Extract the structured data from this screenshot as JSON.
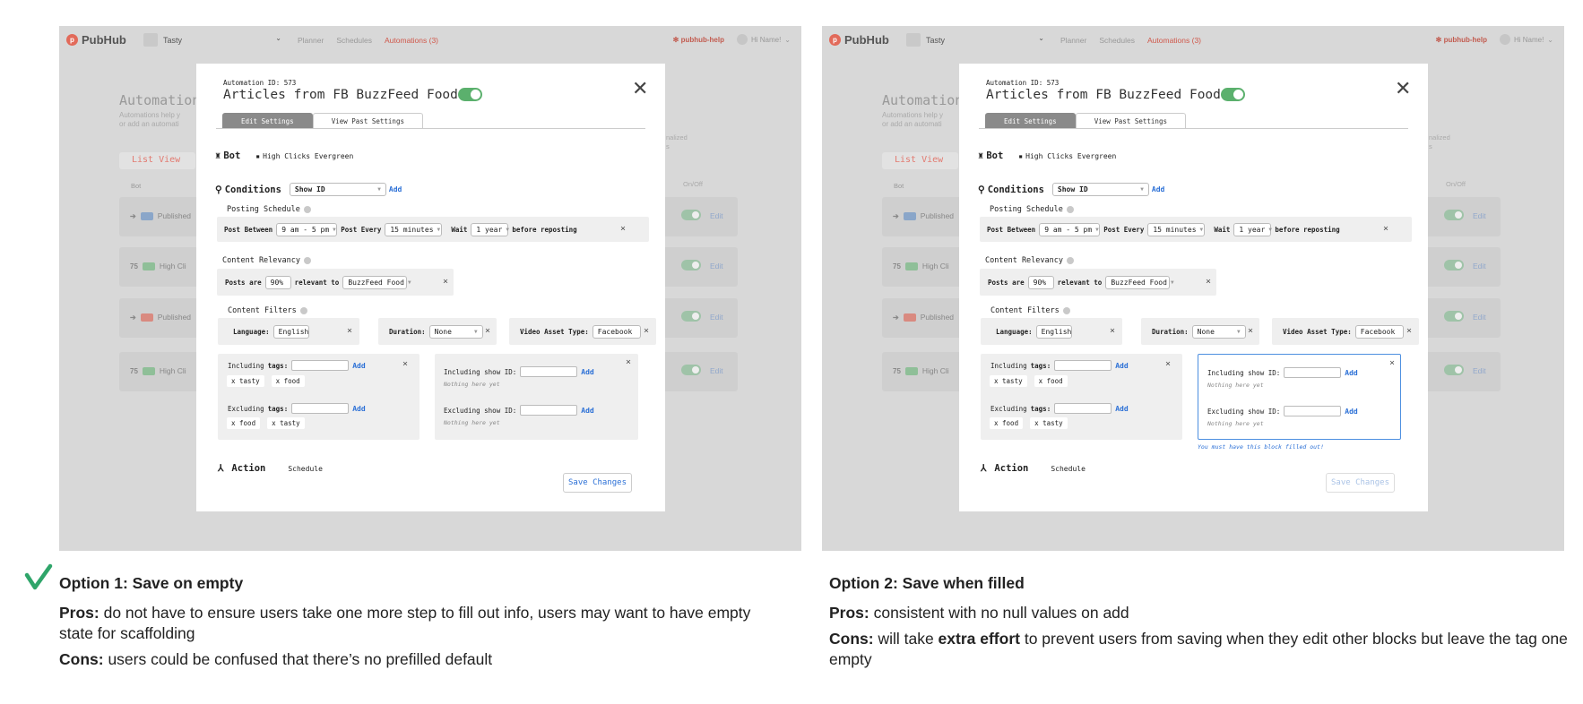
{
  "app": {
    "logo": "PubHub",
    "workspace": "Tasty",
    "nav": [
      "Planner",
      "Schedules",
      "Automations (3)"
    ],
    "help": "pubhub-help",
    "user": "Hi Name!"
  },
  "bg": {
    "title": "Automation",
    "desc": "Automations help y\nor add an automati",
    "list_view": "List View",
    "bot_col": "Bot",
    "onoff_col": "On/Off",
    "pers": "nalized\ns",
    "rows": [
      {
        "label": "Published"
      },
      {
        "label": "High Cli"
      },
      {
        "label": "Published"
      },
      {
        "label": "High Cli"
      }
    ],
    "edit": "Edit"
  },
  "modal": {
    "automation_id": "Automation ID: 573",
    "title": "Articles from FB BuzzFeed Food",
    "tabs": [
      "Edit Settings",
      "View Past Settings"
    ],
    "close": "✕",
    "bot_label": "Bot",
    "bot_value": "High Clicks Evergreen",
    "conditions_label": "Conditions",
    "conditions_select": "Show ID",
    "add": "Add",
    "posting_schedule": "Posting Schedule",
    "post_between": "Post Between",
    "between_val": "9 am - 5 pm",
    "post_every": "Post Every",
    "every_val": "15 minutes",
    "wait": "Wait",
    "wait_val": "1 year",
    "before": "before reposting",
    "content_relevancy": "Content Relevancy",
    "posts_are": "Posts are",
    "pct": "90%",
    "relevant_to": "relevant to",
    "relevant_val": "BuzzFeed Food",
    "content_filters": "Content Filters",
    "language": "Language:",
    "language_val": "English",
    "duration": "Duration:",
    "duration_val": "None",
    "video_type": "Video Asset Type:",
    "video_val": "Facebook",
    "incl_tags": "Including",
    "tags_word": "tags:",
    "excl_tags": "Excluding",
    "incl_tag_chips": [
      "x tasty",
      "x food"
    ],
    "excl_tag_chips": [
      "x food",
      "x tasty"
    ],
    "incl_show": "Including show ID:",
    "excl_show": "Excluding show ID:",
    "nothing": "Nothing here yet",
    "action": "Action",
    "schedule": "Schedule",
    "save": "Save Changes",
    "error": "You must have this block filled out!"
  },
  "options": [
    {
      "title": "Option 1: Save on empty",
      "pros_label": "Pros:",
      "pros": " do not have to ensure users take one more step to fill out info, users may want to have empty state for scaffolding",
      "cons_label": "Cons:",
      "cons": " users could be confused that there’s no prefilled default"
    },
    {
      "title": "Option 2: Save when filled",
      "pros_label": "Pros:",
      "pros": " consistent with no null values on add",
      "cons_label": "Cons:",
      "cons_a": " will take ",
      "cons_b": "extra effort",
      "cons_c": " to prevent users from saving when they edit other blocks but leave the tag one empty"
    }
  ],
  "colors": {
    "check": "#2fa56a",
    "link": "#2a6fd6",
    "toggle": "#5bb06d",
    "nav_active": "#d0584b"
  }
}
